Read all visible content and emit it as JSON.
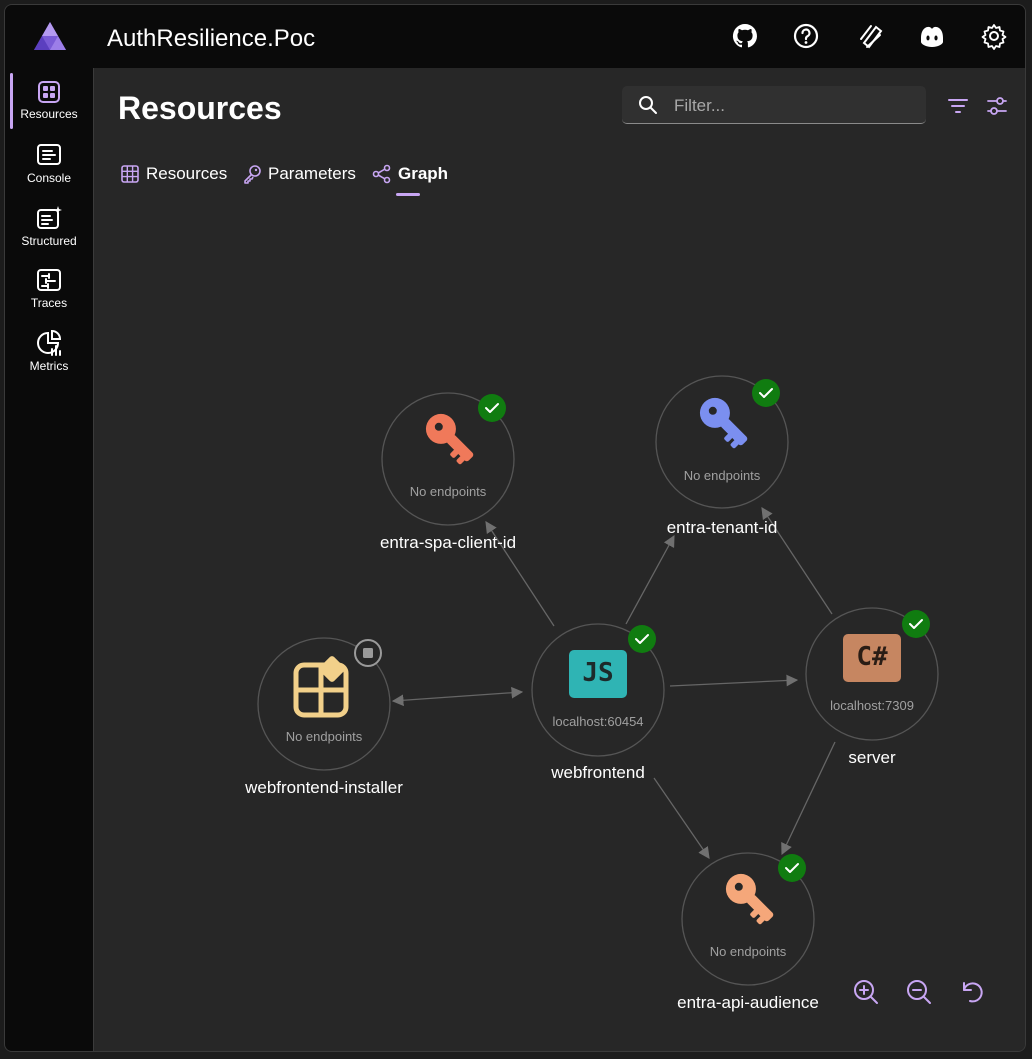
{
  "app": {
    "title": "AuthResilience.Poc"
  },
  "titlebar_icons": [
    "github-icon",
    "help-icon",
    "docs-icon",
    "copilot-icon",
    "settings-icon"
  ],
  "sidebar": {
    "items": [
      {
        "label": "Resources",
        "icon": "resources-icon",
        "active": true
      },
      {
        "label": "Console",
        "icon": "console-icon"
      },
      {
        "label": "Structured",
        "icon": "structured-icon"
      },
      {
        "label": "Traces",
        "icon": "traces-icon"
      },
      {
        "label": "Metrics",
        "icon": "metrics-icon"
      }
    ]
  },
  "page": {
    "title": "Resources"
  },
  "search": {
    "placeholder": "Filter..."
  },
  "tabs": [
    {
      "label": "Resources",
      "icon": "grid-icon"
    },
    {
      "label": "Parameters",
      "icon": "key-icon"
    },
    {
      "label": "Graph",
      "icon": "share-icon",
      "active": true
    }
  ],
  "graph": {
    "nodes": [
      {
        "id": "entra-spa-client-id",
        "label": "entra-spa-client-id",
        "endpoint": "No endpoints",
        "state": "running",
        "icon": "key-icon",
        "color": "#f0795a"
      },
      {
        "id": "entra-tenant-id",
        "label": "entra-tenant-id",
        "endpoint": "No endpoints",
        "state": "running",
        "icon": "key-icon",
        "color": "#7b8ff0"
      },
      {
        "id": "webfrontend-installer",
        "label": "webfrontend-installer",
        "endpoint": "No endpoints",
        "state": "stopped",
        "icon": "installer-icon",
        "color": "#f2d08a"
      },
      {
        "id": "webfrontend",
        "label": "webfrontend",
        "endpoint": "localhost:60454",
        "state": "running",
        "icon": "js-icon",
        "color": "#2fb4b4",
        "badge": "JS"
      },
      {
        "id": "server",
        "label": "server",
        "endpoint": "localhost:7309",
        "state": "running",
        "icon": "csharp-icon",
        "color": "#c68661",
        "badge": "C#"
      },
      {
        "id": "entra-api-audience",
        "label": "entra-api-audience",
        "endpoint": "No endpoints",
        "state": "running",
        "icon": "key-icon",
        "color": "#f5a77a"
      }
    ],
    "edges": [
      {
        "from": "webfrontend",
        "to": "entra-spa-client-id"
      },
      {
        "from": "webfrontend",
        "to": "entra-tenant-id"
      },
      {
        "from": "webfrontend",
        "to": "webfrontend-installer",
        "bidirectional": true
      },
      {
        "from": "webfrontend",
        "to": "server"
      },
      {
        "from": "webfrontend",
        "to": "entra-api-audience"
      },
      {
        "from": "server",
        "to": "entra-tenant-id"
      },
      {
        "from": "server",
        "to": "entra-api-audience"
      }
    ],
    "status_colors": {
      "running": "#107c10",
      "stopped": "#3a3a3a",
      "edge": "#6a6a6a",
      "ring": "#5a5a5a"
    }
  },
  "zoom_controls": [
    "zoom-in-icon",
    "zoom-out-icon",
    "reset-icon"
  ]
}
